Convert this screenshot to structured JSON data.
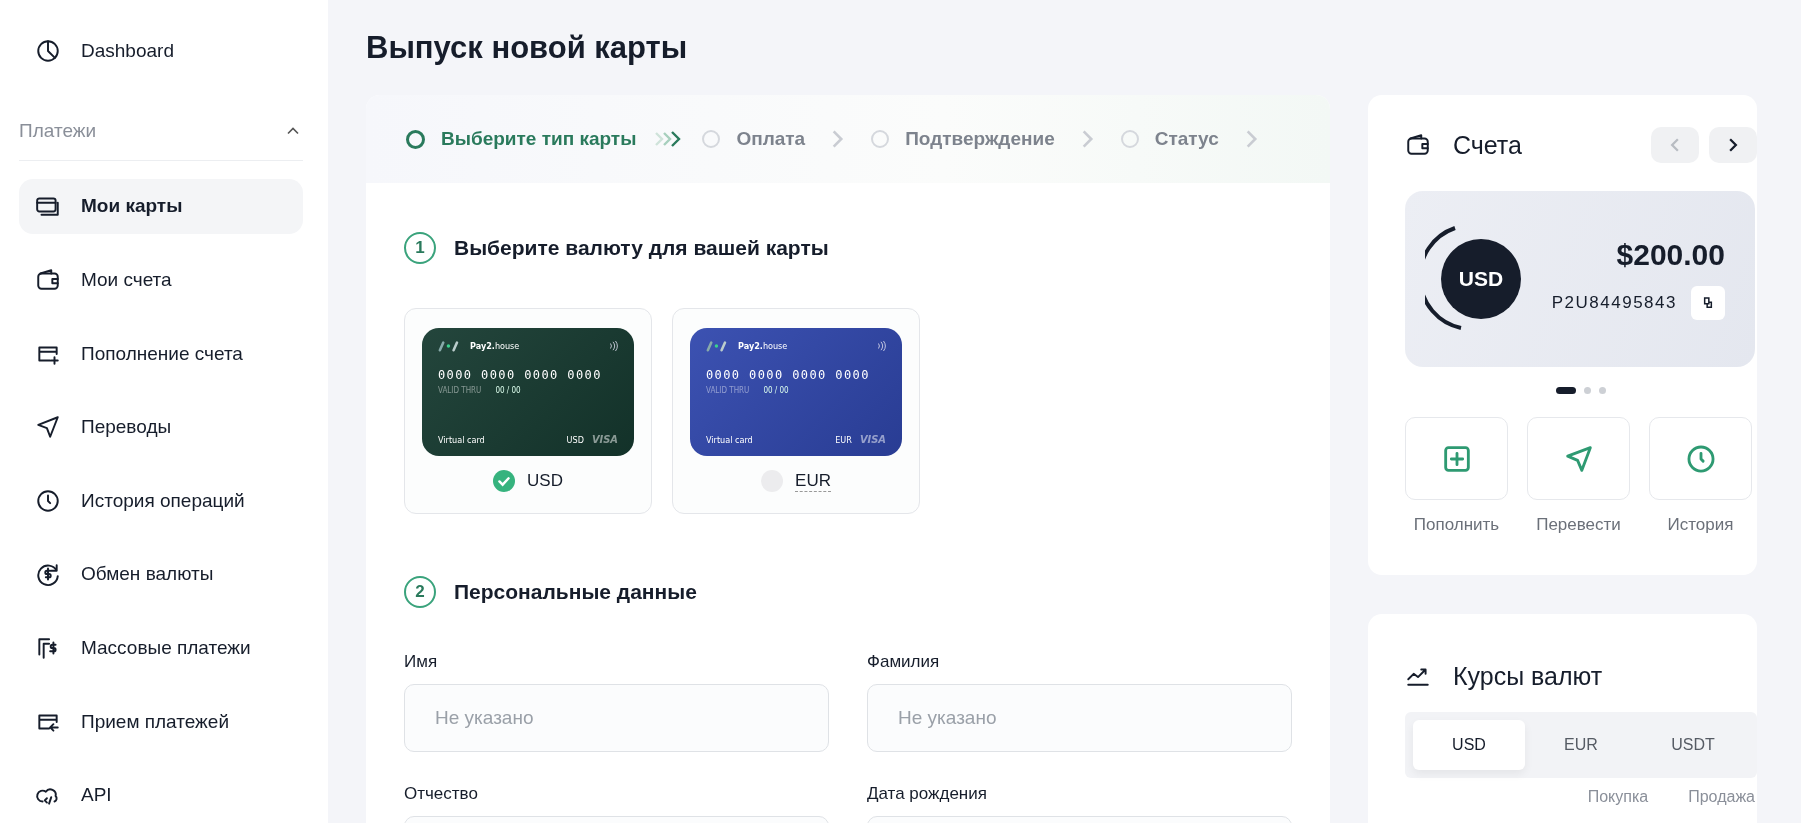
{
  "sidebar": {
    "top_item": {
      "label": "Dashboard"
    },
    "section": {
      "title": "Платежи",
      "expanded": true
    },
    "items": [
      {
        "label": "Мои карты",
        "selected": true
      },
      {
        "label": "Мои счета",
        "selected": false
      },
      {
        "label": "Пополнение счета",
        "selected": false
      },
      {
        "label": "Переводы",
        "selected": false
      },
      {
        "label": "История операций",
        "selected": false
      },
      {
        "label": "Обмен валюты",
        "selected": false
      },
      {
        "label": "Массовые платежи",
        "selected": false
      },
      {
        "label": "Прием платежей",
        "selected": false
      },
      {
        "label": "API",
        "selected": false
      }
    ]
  },
  "page_title": "Выпуск новой карты",
  "stepper": [
    {
      "label": "Выберите тип карты",
      "selected": true
    },
    {
      "label": "Оплата",
      "selected": false
    },
    {
      "label": "Подтверждение",
      "selected": false
    },
    {
      "label": "Статус",
      "selected": false
    }
  ],
  "currency_section": {
    "number": "1",
    "title": "Выберите валюту для вашей карты",
    "options": [
      {
        "currency": "USD",
        "selected": true,
        "color": "#163a30",
        "card": {
          "brand": "**Pay2.**house",
          "number": "0000 0000 0000 0000",
          "valid_label": "VALID THRU",
          "valid": "00 / 00",
          "type": "Virtual card",
          "currency": "USD",
          "network": "VISA"
        }
      },
      {
        "currency": "EUR",
        "selected": false,
        "color": "#3047ad",
        "card": {
          "brand": "**Pay2.**house",
          "number": "0000 0000 0000 0000",
          "valid_label": "VALID THRU",
          "valid": "00 / 00",
          "type": "Virtual card",
          "currency": "EUR",
          "network": "VISA"
        }
      }
    ]
  },
  "personal_section": {
    "number": "2",
    "title": "Персональные данные",
    "fields": [
      {
        "label": "Имя",
        "placeholder": "Не указано"
      },
      {
        "label": "Фамилия",
        "placeholder": "Не указано"
      },
      {
        "label": "Отчество"
      },
      {
        "label": "Дата рождения"
      }
    ]
  },
  "accounts": {
    "title": "Счета",
    "prev_disabled": true,
    "next_disabled": false,
    "account": {
      "currency": "USD",
      "balance": "$200.00",
      "number": "P2U84495843"
    },
    "pager": [
      {
        "selected": true
      },
      {
        "selected": false
      },
      {
        "selected": false
      }
    ],
    "actions": [
      {
        "label": "Пополнить"
      },
      {
        "label": "Перевести"
      },
      {
        "label": "История"
      }
    ]
  },
  "rates": {
    "title": "Курсы валют",
    "tabs": [
      {
        "label": "USD",
        "selected": true
      },
      {
        "label": "EUR",
        "selected": false
      },
      {
        "label": "USDT",
        "selected": false
      }
    ],
    "columns": [
      "Покупка",
      "Продажа"
    ]
  }
}
